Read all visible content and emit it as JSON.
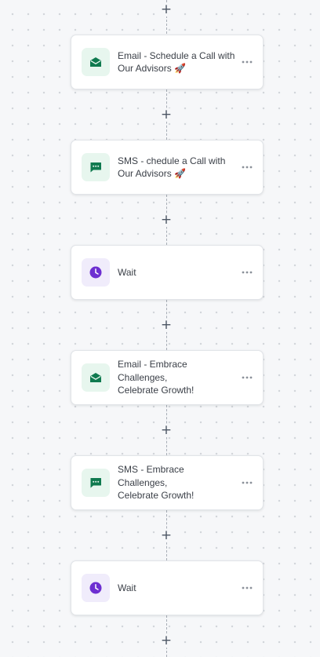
{
  "flow": {
    "add_symbol": "+",
    "more_symbol": "more-dots-icon",
    "nodes": [
      {
        "type": "email",
        "label": "Email - Schedule a Call with\nOur Advisors 🚀",
        "icon": "email-icon"
      },
      {
        "type": "sms",
        "label": "SMS - chedule a Call with\nOur Advisors 🚀",
        "icon": "sms-icon"
      },
      {
        "type": "wait",
        "label": "Wait",
        "icon": "clock-icon"
      },
      {
        "type": "email",
        "label": "Email - Embrace Challenges,\nCelebrate Growth!",
        "icon": "email-icon"
      },
      {
        "type": "sms",
        "label": "SMS - Embrace Challenges,\nCelebrate Growth!",
        "icon": "sms-icon"
      },
      {
        "type": "wait",
        "label": "Wait",
        "icon": "clock-icon"
      }
    ]
  },
  "colors": {
    "email_icon": "#0f7a4f",
    "sms_icon": "#0f7a4f",
    "wait_icon": "#6d2fd1",
    "canvas": "#f6f7f9"
  }
}
